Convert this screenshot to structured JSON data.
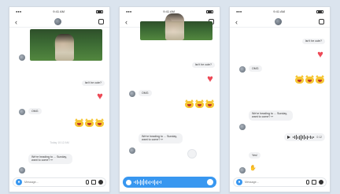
{
  "phones": [
    {
      "status": {
        "time": "9:41 AM"
      },
      "messages": {
        "sent_text": "Isn't he cute?",
        "received_text": "OMG",
        "timestamp": "Today 10:12 AM",
        "last_received_text": "We're heading to ... Sunday, want to come? ✏"
      },
      "composer": {
        "placeholder": "Message..."
      }
    },
    {
      "status": {
        "time": "9:41 AM"
      },
      "messages": {
        "sent_text": "Isn't he cute?",
        "received_text": "OMG",
        "last_received_text": "We're heading to ... Sunday, want to come? ✏"
      }
    },
    {
      "status": {
        "time": "9:41 AM"
      },
      "messages": {
        "sent_text": "Isn't he cute?",
        "received_text": "OMG",
        "last_received_text": "We're heading to ... Sunday, want to come? ✏",
        "voice_duration": "0:12",
        "small_text": "Yes!"
      },
      "composer": {
        "placeholder": "Message..."
      }
    }
  ],
  "icons": {
    "back": "chevron-left-icon",
    "info": "info-icon",
    "heart": "heart-icon",
    "camera": "camera-icon",
    "mic": "mic-icon",
    "gallery": "gallery-icon",
    "plus": "plus-icon",
    "play": "play-icon",
    "trash": "trash-icon"
  },
  "colors": {
    "background": "#dbe4ee",
    "accent_blue": "#3897f0",
    "heart_red": "#ed4956",
    "bubble_gray": "#f1f2f4"
  }
}
